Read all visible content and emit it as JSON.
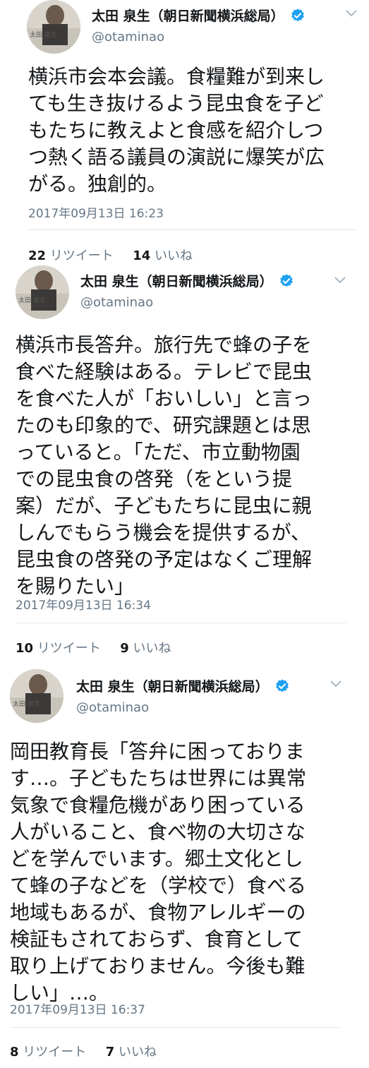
{
  "colors": {
    "verified": "#1da1f2",
    "secondary_text": "#657786",
    "primary_text": "#14171a",
    "divider": "#e1e8ed"
  },
  "tweets": [
    {
      "author": {
        "display_name": "太田 泉生（朝日新聞横浜総局）",
        "handle": "@otaminao",
        "verified": true
      },
      "text": "横浜市会本会議。食糧難が到来し\nても生き抜けるよう昆虫食を子ど\nもたちに教えよと食感を紹介しつ\nつ熱く語る議員の演説に爆笑が広\nがる。独創的。",
      "timestamp": "2017年09月13日 16:23",
      "retweets": "22",
      "retweet_label": "リツイート",
      "likes": "14",
      "like_label": "いいね"
    },
    {
      "author": {
        "display_name": "太田 泉生（朝日新聞横浜総局）",
        "handle": "@otaminao",
        "verified": true
      },
      "text": "横浜市長答弁。旅行先で蜂の子を\n食べた経験はある。テレビで昆虫\nを食べた人が「おいしい」と言っ\nたのも印象的で、研究課題とは思\nっていると。「ただ、市立動物園\nでの昆虫食の啓発（をという提\n案）だが、子どもたちに昆虫に親\nしんでもらう機会を提供するが、\n昆虫食の啓発の予定はなくご理解\nを賜りたい」",
      "timestamp": "2017年09月13日 16:34",
      "retweets": "10",
      "retweet_label": "リツイート",
      "likes": "9",
      "like_label": "いいね"
    },
    {
      "author": {
        "display_name": "太田 泉生（朝日新聞横浜総局）",
        "handle": "@otaminao",
        "verified": true
      },
      "text": "岡田教育長「答弁に困っておりま\nす…。子どもたちは世界には異常\n気象で食糧危機があり困っている\n人がいること、食べ物の大切さな\nどを学んでいます。郷土文化とし\nて蜂の子などを（学校で）食べる\n地域もあるが、食物アレルギーの\n検証もされておらず、食育として\n取り上げておりません。今後も難\nしい」…。",
      "timestamp": "2017年09月13日 16:37",
      "retweets": "8",
      "retweet_label": "リツイート",
      "likes": "7",
      "like_label": "いいね"
    }
  ]
}
